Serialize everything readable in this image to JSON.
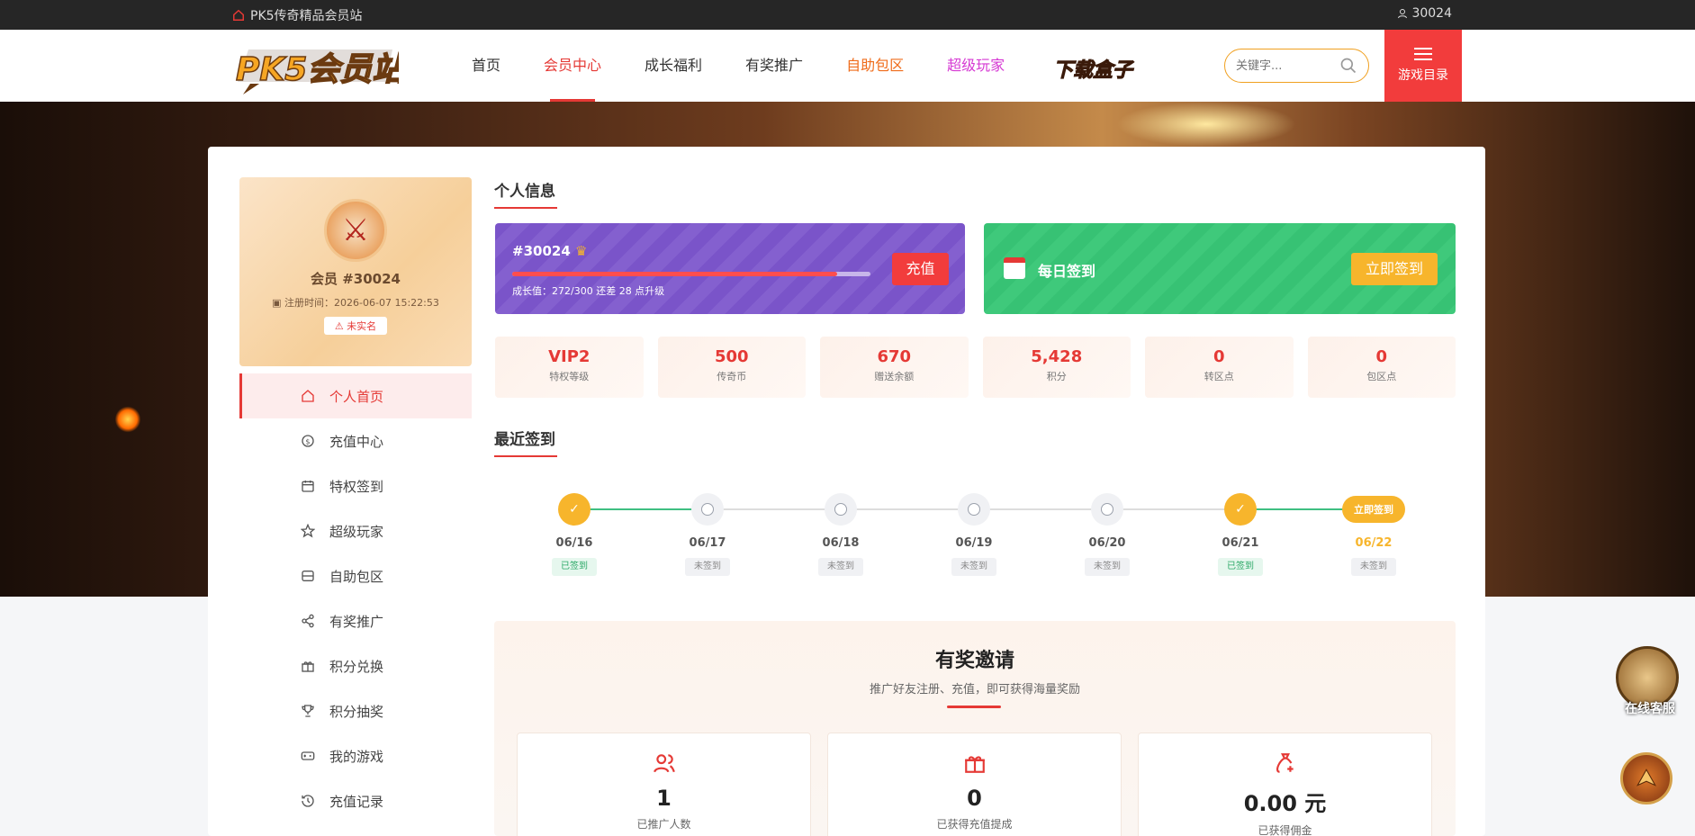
{
  "topbar": {
    "site_name": "PK5传奇精品会员站",
    "user_id": "30024"
  },
  "header": {
    "logo_text": "PK5会员站",
    "nav": [
      {
        "label": "首页"
      },
      {
        "label": "会员中心"
      },
      {
        "label": "成长福利"
      },
      {
        "label": "有奖推广"
      },
      {
        "label": "自助包区"
      },
      {
        "label": "超级玩家"
      }
    ],
    "download_box": "下载盒子",
    "search_placeholder": "关键字...",
    "menu_label": "游戏目录"
  },
  "profile": {
    "name": "会员 #30024",
    "reg_time": "注册时间：2026-06-07 15:22:53",
    "verify_badge": "未实名"
  },
  "sidebar": {
    "items": [
      {
        "label": "个人首页"
      },
      {
        "label": "充值中心"
      },
      {
        "label": "特权签到"
      },
      {
        "label": "超级玩家"
      },
      {
        "label": "自助包区"
      },
      {
        "label": "有奖推广"
      },
      {
        "label": "积分兑换"
      },
      {
        "label": "积分抽奖"
      },
      {
        "label": "我的游戏"
      },
      {
        "label": "充值记录"
      }
    ]
  },
  "personal": {
    "title": "个人信息",
    "uid": "#30024",
    "growth_text": "成长值：272/300 还差 28 点升级",
    "growth_progress": 0.907,
    "recharge_button": "充值",
    "daily_sign_label": "每日签到",
    "sign_button": "立即签到"
  },
  "stats": [
    {
      "value": "VIP2",
      "label": "特权等级"
    },
    {
      "value": "500",
      "label": "传奇币"
    },
    {
      "value": "670",
      "label": "赠送余额"
    },
    {
      "value": "5,428",
      "label": "积分"
    },
    {
      "value": "0",
      "label": "转区点"
    },
    {
      "value": "0",
      "label": "包区点"
    }
  ],
  "checkin": {
    "title": "最近签到",
    "days": [
      {
        "date": "06/16",
        "status": "已签到"
      },
      {
        "date": "06/17",
        "status": "未签到"
      },
      {
        "date": "06/18",
        "status": "未签到"
      },
      {
        "date": "06/19",
        "status": "未签到"
      },
      {
        "date": "06/20",
        "status": "未签到"
      },
      {
        "date": "06/21",
        "status": "已签到"
      },
      {
        "date": "06/22",
        "status": "未签到",
        "action": "立即签到"
      }
    ],
    "check_mark": "✓"
  },
  "invite": {
    "title": "有奖邀请",
    "subtitle": "推广好友注册、充值，即可获得海量奖励",
    "boxes": [
      {
        "value": "1",
        "label": "已推广人数"
      },
      {
        "value": "0",
        "label": "已获得充值提成"
      },
      {
        "value": "0.00 元",
        "label": "已获得佣金"
      }
    ]
  },
  "float": {
    "service_label": "在线客服"
  },
  "colors": {
    "accent": "#e53935",
    "vip_purple": "#7a54c9",
    "sign_green": "#37c274",
    "gold": "#f7b52c"
  }
}
